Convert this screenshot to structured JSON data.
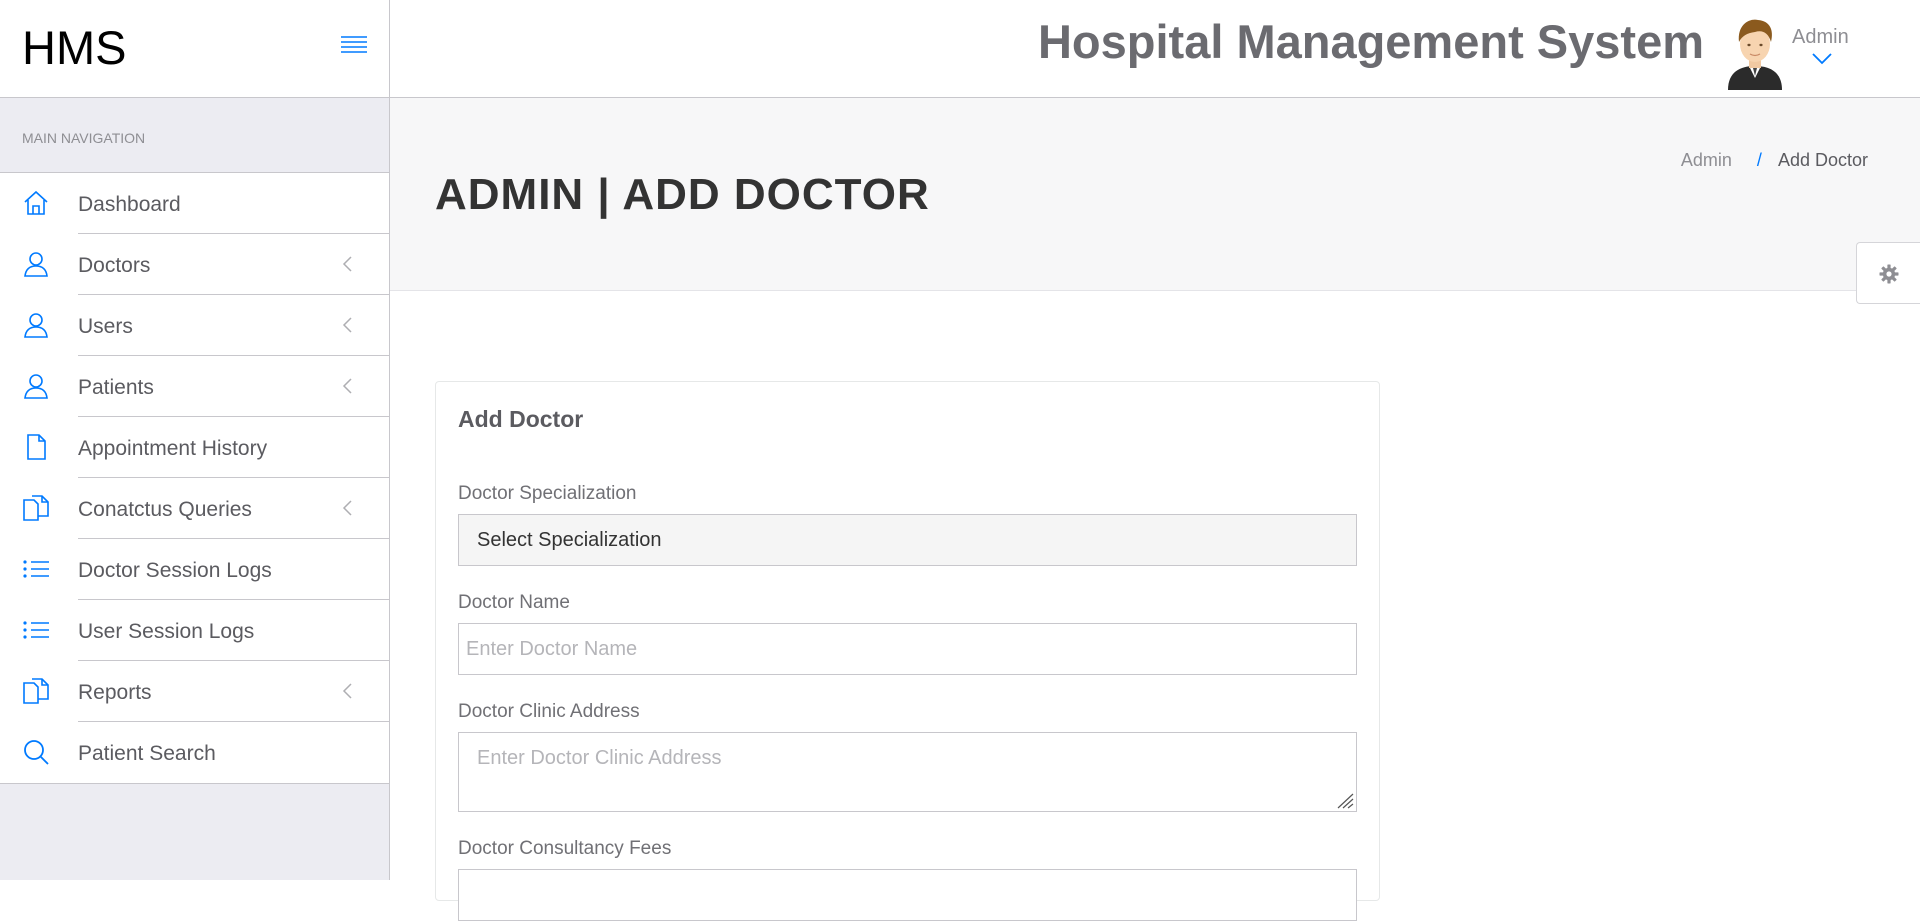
{
  "brand": {
    "name": "HMS"
  },
  "header": {
    "title": "Hospital Management System",
    "user_name": "Admin",
    "icons": {
      "menu": "hamburger-icon",
      "avatar": "user-avatar",
      "dropdown": "chevron-down-icon"
    }
  },
  "sidebar": {
    "heading": "MAIN NAVIGATION",
    "items": [
      {
        "label": "Dashboard",
        "icon": "home-icon",
        "has_submenu": false
      },
      {
        "label": "Doctors",
        "icon": "user-icon",
        "has_submenu": true
      },
      {
        "label": "Users",
        "icon": "user-icon",
        "has_submenu": true
      },
      {
        "label": "Patients",
        "icon": "user-icon",
        "has_submenu": true
      },
      {
        "label": "Appointment History",
        "icon": "file-icon",
        "has_submenu": false
      },
      {
        "label": "Conatctus Queries",
        "icon": "files-icon",
        "has_submenu": true
      },
      {
        "label": "Doctor Session Logs",
        "icon": "list-icon",
        "has_submenu": false
      },
      {
        "label": "User Session Logs",
        "icon": "list-icon",
        "has_submenu": false
      },
      {
        "label": "Reports",
        "icon": "files-icon",
        "has_submenu": true
      },
      {
        "label": "Patient Search",
        "icon": "search-icon",
        "has_submenu": false
      }
    ]
  },
  "page": {
    "title": "ADMIN | ADD DOCTOR",
    "breadcrumb": {
      "home": "Admin",
      "separator": "/",
      "current": "Add Doctor"
    }
  },
  "form": {
    "panel_title": "Add Doctor",
    "specialization_label": "Doctor Specialization",
    "specialization_value": "Select Specialization",
    "name_label": "Doctor Name",
    "name_placeholder": "Enter Doctor Name",
    "address_label": "Doctor Clinic Address",
    "address_placeholder": "Enter Doctor Clinic Address",
    "fees_label": "Doctor Consultancy Fees"
  },
  "colors": {
    "accent": "#007aff",
    "sidebar_bg": "#ececf2",
    "border": "#c8c7cc"
  }
}
